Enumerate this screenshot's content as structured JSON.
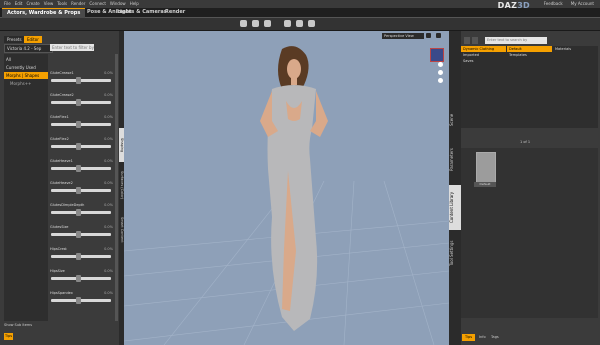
{
  "menubar": {
    "items": [
      "File",
      "Edit",
      "Create",
      "View",
      "Tools",
      "Render",
      "Connect",
      "Window",
      "Help"
    ],
    "logo_main": "DAZ",
    "logo_accent": "3D",
    "links": [
      "Feedback",
      "My Account"
    ]
  },
  "tabs": [
    "Actors, Wardrobe & Props",
    "Pose & Animate",
    "Lights & Cameras",
    "Render"
  ],
  "left_panel": {
    "tabs": [
      "Presets",
      "Editor"
    ],
    "preset_selector": "Victoria 4.2 - Sep",
    "filter_placeholder": "Enter text to filter by",
    "list": [
      {
        "label": "All",
        "kind": "normal"
      },
      {
        "label": "Currently Used",
        "kind": "normal"
      },
      {
        "label": "Morphs | Shapes",
        "kind": "selected"
      },
      {
        "label": "Morphs++",
        "kind": "sub"
      }
    ],
    "sliders": [
      {
        "label": "GluteCrease1",
        "value": "0.0%",
        "level": 0.45
      },
      {
        "label": "GluteCrease2",
        "value": "0.0%",
        "level": 0.45
      },
      {
        "label": "GluteFlex1",
        "value": "0.0%",
        "level": 0.45
      },
      {
        "label": "GluteFlex2",
        "value": "0.0%",
        "level": 0.45
      },
      {
        "label": "GluteHeave1",
        "value": "0.0%",
        "level": 0.45
      },
      {
        "label": "GluteHeave2",
        "value": "0.0%",
        "level": 0.45
      },
      {
        "label": "GlutesDimpleDepth",
        "value": "0.0%",
        "level": 0.45
      },
      {
        "label": "GlutesSize",
        "value": "0.0%",
        "level": 0.45
      },
      {
        "label": "HipsCrest",
        "value": "0.0%",
        "level": 0.45
      },
      {
        "label": "HipsSize",
        "value": "0.0%",
        "level": 0.45
      },
      {
        "label": "HipsSpandex",
        "value": "0.0%",
        "level": 0.45
      }
    ],
    "side_tabs": [
      "Shaping",
      "Surfaces (Color)",
      "Smart Content"
    ],
    "show_sub": "Show Sub Items",
    "bottom_button": "Tips"
  },
  "viewport": {
    "camera": "Perspective View"
  },
  "right_panel": {
    "side_tabs": [
      "Scene",
      "Parameters",
      "Content Library",
      "Tool Settings"
    ],
    "search_placeholder": "Enter text to search by",
    "tree": {
      "col1": [
        {
          "label": "Dynamic Clothing",
          "sel": true
        },
        {
          "label": "Imported",
          "sel": false
        },
        {
          "label": "Saves",
          "sel": false
        }
      ],
      "col2": [
        {
          "label": "Default",
          "sel": true
        },
        {
          "label": "Templates",
          "sel": false
        }
      ],
      "col3": [
        {
          "label": "Materials",
          "sel": false
        }
      ]
    },
    "page_indicator": "1 of 1",
    "thumb_label": "Default",
    "bottom_tabs": [
      "Tips",
      "Info",
      "Tags"
    ]
  }
}
